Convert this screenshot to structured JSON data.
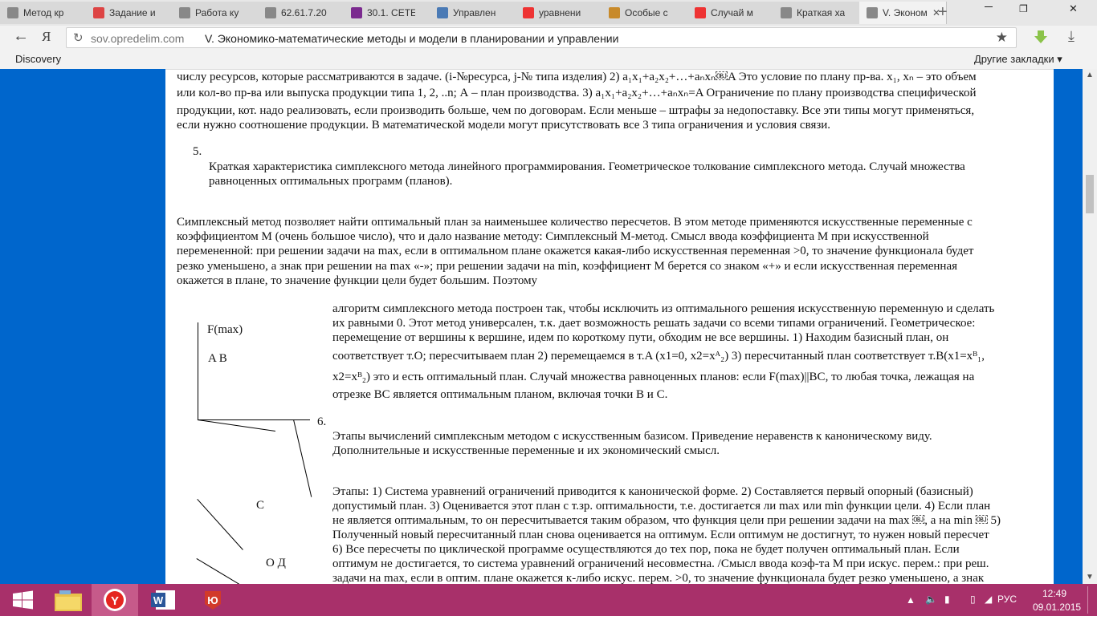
{
  "tabs": [
    {
      "label": "Метод кр",
      "icon": "globe-icon",
      "color": "#888"
    },
    {
      "label": "Задание и",
      "icon": "gmail-icon",
      "color": "#d44"
    },
    {
      "label": "Работа ку",
      "icon": "doc-icon",
      "color": "#888"
    },
    {
      "label": "62.61.7.20",
      "icon": "doc-icon",
      "color": "#888"
    },
    {
      "label": "30.1. СЕТЕ",
      "icon": "star-icon",
      "color": "#7b2a8f"
    },
    {
      "label": "Управлен",
      "icon": "rocket-icon",
      "color": "#4a7ab5"
    },
    {
      "label": "уравнени",
      "icon": "yandex-icon",
      "color": "#e33"
    },
    {
      "label": "Особые с",
      "icon": "hat-icon",
      "color": "#c88a2a"
    },
    {
      "label": "Случай м",
      "icon": "yandex-icon",
      "color": "#e33"
    },
    {
      "label": "Краткая ха",
      "icon": "doc-icon",
      "color": "#888"
    },
    {
      "label": "V. Эконом",
      "icon": "doc-icon",
      "color": "#888",
      "active": true
    }
  ],
  "address": {
    "domain": "sov.opredelim.com",
    "title": "V. Экономико-математические методы и модели в планировании и управлении"
  },
  "bookmarks": {
    "discovery": "Discovery",
    "other": "Другие закладки ▾"
  },
  "content": {
    "p1_l1": "числу ресурсов, которые рассматриваются в задаче. (i-№ресурса, j-№ типа изделия) 2) a₁x₁+a₂x₂+…+aₙxₙ￼A Это условие по плану пр-ва. x₁, xₙ – это объем",
    "p1_l2": "или кол-во пр-ва или выпуска продукции типа 1, 2, ..n; А – план производства. 3) a₁x₁+a₂x₂+…+aₙxₙ=A Ограничение по плану производства специфической",
    "p1_l3": "продукции, кот. надо реализовать, если производить больше, чем по договорам. Если меньше – штрафы за недопоставку. Все эти типы могут применяться,",
    "p1_l4": "если нужно соотношение продукции. В математической модели могут присутствовать все 3 типа ограничения и условия связи.",
    "item5_num": "5.",
    "item5_l1": "Краткая характеристика симплексного метода линейного программирования. Геометрическое толкование симплексного метода. Случай множества",
    "item5_l2": "равноценных оптимальных программ (планов).",
    "p2_l1": "Симплексный метод позволяет найти оптимальный план за наименьшее количество пересчетов. В этом методе применяются искусственные переменные с",
    "p2_l2": "коэффициентом М (очень большое число), что и дало название методу: Симплексный М-метод. Смысл ввода коэффициента М при искусственной",
    "p2_l3": "перемененной: при решении задачи на max, если в оптимальном плане окажется какая-либо искусственная переменная >0, то значение функционала будет",
    "p2_l4": "резко уменьшено, а знак при решении на max «-»; при решении задачи на min, коэффициент М берется со знаком «+» и если искусственная переменная",
    "p2_l5": "окажется в плане, то значение функции цели будет большим. Поэтому",
    "fig_fmax": "F(max)",
    "fig_ab": "A B",
    "fig_c": "C",
    "fig_od": "O Д",
    "p3_l1": "алгоритм симплексного метода построен так, чтобы исключить из оптимального решения искусственную переменную и сделать",
    "p3_l2": "их равными 0. Этот метод универсален, т.к. дает возможность решать задачи со всеми типами ограничений. Геометрическое:",
    "p3_l3": "перемещение от вершины к вершине, идем по короткому пути, обходим не все вершины. 1) Находим базисный план, он",
    "p3_l4": "соответствует т.О; пересчитываем план 2) перемещаемся в т.A (x1=0, x2=xᴬ₂) 3) пересчитанный план соответствует т.B(x1=xᴮ₁,",
    "p3_l5": "x2=xᴮ₂) это и есть оптимальный план. Случай множества равноценных планов: если F(max)||BC, то любая точка, лежащая на",
    "p3_l6": "отрезке BC является оптимальным планом, включая точки B и C.",
    "item6_num": "6.",
    "item6_l1": "Этапы вычислений симплексным методом с искусственным базисом. Приведение неравенств к каноническому виду.",
    "item6_l2": "Дополнительные и искусственные переменные и их экономический смысл.",
    "p4_l1": "Этапы: 1) Система уравнений ограничений приводится к канонической форме. 2) Составляется первый опорный (базисный)",
    "p4_l2": "допустимый план. 3) Оценивается этот план с т.зр. оптимальности, т.е. достигается ли max или min функции цели. 4) Если план",
    "p4_l3": "не является оптимальным, то он пересчитывается таким образом, что функция цели при решении задачи на max ￼, а на min ￼ 5)",
    "p4_l4": "Полученный новый пересчитанный план снова оценивается на оптимум. Если оптимум не достигнут, то нужен новый пересчет",
    "p4_l5": "6) Все пересчеты по циклической программе осуществляются до тех пор, пока не будет получен оптимальный план. Если",
    "p4_l6": "оптимум не достигается, то система уравнений ограничений несовместна. /Смысл ввода коэф-та М при искус. перем.: при реш.",
    "p4_l7": "задачи на max, если в оптим. плане окажется к-либо искус. перем. >0, то значение функционала будет резко уменьшено, а знак"
  },
  "taskbar": {
    "items": [
      {
        "name": "start-button",
        "icon": "windows-icon"
      },
      {
        "name": "explorer-button",
        "icon": "folder-icon"
      },
      {
        "name": "yandex-browser-button",
        "icon": "yandex-browser-icon",
        "active": true
      },
      {
        "name": "word-button",
        "icon": "word-icon"
      },
      {
        "name": "app-button",
        "icon": "shield-app-icon"
      }
    ],
    "lang": "РУС",
    "time": "12:49",
    "date": "09.01.2015"
  }
}
